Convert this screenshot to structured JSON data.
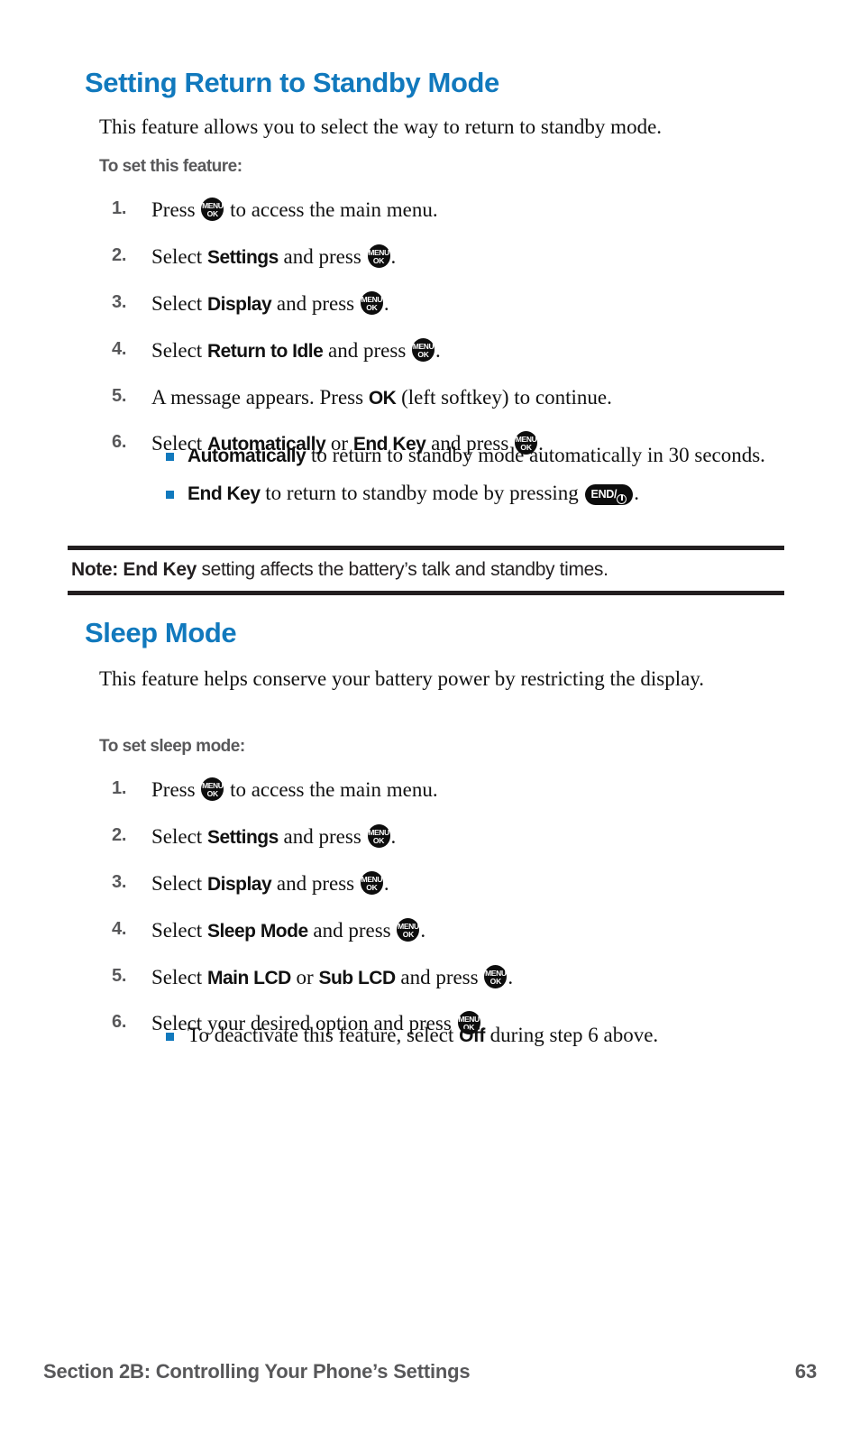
{
  "page": {
    "number": "63",
    "footer_left": "Section 2B: Controlling Your Phone’s Settings",
    "accent_color": "#1179bd",
    "text_color": "#111111",
    "muted_color": "#58585a"
  },
  "icons": {
    "menu_ok": {
      "name": "menu-ok-key-icon",
      "line1": "MENU",
      "line2": "OK"
    },
    "end_power": {
      "name": "end-power-key-icon",
      "label": "END/"
    }
  },
  "sections": [
    {
      "id": "setting-return-to-standby-mode",
      "heading": "Setting Return to Standby Mode",
      "intro": "This feature allows you to select the way to return to standby mode.",
      "subhead": "To set this feature:",
      "steps": [
        {
          "num": "1.",
          "parts": [
            {
              "t": "text",
              "v": "Press "
            },
            {
              "t": "icon",
              "v": "menu_ok"
            },
            {
              "t": "text",
              "v": " to access the main menu."
            }
          ]
        },
        {
          "num": "2.",
          "parts": [
            {
              "t": "text",
              "v": "Select "
            },
            {
              "t": "kw",
              "v": "Settings"
            },
            {
              "t": "text",
              "v": " and press "
            },
            {
              "t": "icon",
              "v": "menu_ok"
            },
            {
              "t": "text",
              "v": "."
            }
          ]
        },
        {
          "num": "3.",
          "parts": [
            {
              "t": "text",
              "v": "Select "
            },
            {
              "t": "kw",
              "v": "Display"
            },
            {
              "t": "text",
              "v": " and press "
            },
            {
              "t": "icon",
              "v": "menu_ok"
            },
            {
              "t": "text",
              "v": "."
            }
          ]
        },
        {
          "num": "4.",
          "parts": [
            {
              "t": "text",
              "v": "Select "
            },
            {
              "t": "kw",
              "v": "Return to Idle"
            },
            {
              "t": "text",
              "v": " and press "
            },
            {
              "t": "icon",
              "v": "menu_ok"
            },
            {
              "t": "text",
              "v": "."
            }
          ]
        },
        {
          "num": "5.",
          "parts": [
            {
              "t": "text",
              "v": "A message appears. Press "
            },
            {
              "t": "kw",
              "v": "OK"
            },
            {
              "t": "text",
              "v": " (left softkey) to continue."
            }
          ]
        },
        {
          "num": "6.",
          "parts": [
            {
              "t": "text",
              "v": "Select "
            },
            {
              "t": "kw",
              "v": "Automatically"
            },
            {
              "t": "text",
              "v": " or "
            },
            {
              "t": "kw",
              "v": "End Key"
            },
            {
              "t": "text",
              "v": " and press "
            },
            {
              "t": "icon",
              "v": "menu_ok"
            },
            {
              "t": "text",
              "v": "."
            }
          ]
        }
      ],
      "bullets": [
        {
          "parts": [
            {
              "t": "kw",
              "v": "Automatically"
            },
            {
              "t": "text",
              "v": " to return to standby mode automatically in 30 seconds."
            }
          ]
        },
        {
          "parts": [
            {
              "t": "kw",
              "v": "End Key"
            },
            {
              "t": "text",
              "v": " to return to standby mode by pressing "
            },
            {
              "t": "icon",
              "v": "end_power"
            },
            {
              "t": "text",
              "v": "."
            }
          ]
        }
      ],
      "note": [
        {
          "t": "nb",
          "v": "Note: "
        },
        {
          "t": "nb",
          "v": "End Key"
        },
        {
          "t": "text",
          "v": " setting affects the battery’s talk and standby times."
        }
      ]
    },
    {
      "id": "sleep-mode",
      "heading": "Sleep Mode",
      "intro": "This feature helps conserve your battery power by restricting the display.",
      "subhead": "To set sleep mode:",
      "steps": [
        {
          "num": "1.",
          "parts": [
            {
              "t": "text",
              "v": "Press "
            },
            {
              "t": "icon",
              "v": "menu_ok"
            },
            {
              "t": "text",
              "v": " to access the main menu."
            }
          ]
        },
        {
          "num": "2.",
          "parts": [
            {
              "t": "text",
              "v": "Select "
            },
            {
              "t": "kw",
              "v": "Settings"
            },
            {
              "t": "text",
              "v": " and press "
            },
            {
              "t": "icon",
              "v": "menu_ok"
            },
            {
              "t": "text",
              "v": "."
            }
          ]
        },
        {
          "num": "3.",
          "parts": [
            {
              "t": "text",
              "v": "Select "
            },
            {
              "t": "kw",
              "v": "Display"
            },
            {
              "t": "text",
              "v": " and press "
            },
            {
              "t": "icon",
              "v": "menu_ok"
            },
            {
              "t": "text",
              "v": "."
            }
          ]
        },
        {
          "num": "4.",
          "parts": [
            {
              "t": "text",
              "v": "Select "
            },
            {
              "t": "kw",
              "v": "Sleep Mode"
            },
            {
              "t": "text",
              "v": " and press "
            },
            {
              "t": "icon",
              "v": "menu_ok"
            },
            {
              "t": "text",
              "v": "."
            }
          ]
        },
        {
          "num": "5.",
          "parts": [
            {
              "t": "text",
              "v": "Select "
            },
            {
              "t": "kw",
              "v": "Main LCD"
            },
            {
              "t": "text",
              "v": " or "
            },
            {
              "t": "kw",
              "v": "Sub LCD"
            },
            {
              "t": "text",
              "v": " and press "
            },
            {
              "t": "icon",
              "v": "menu_ok"
            },
            {
              "t": "text",
              "v": "."
            }
          ]
        },
        {
          "num": "6.",
          "parts": [
            {
              "t": "text",
              "v": "Select your desired option and press "
            },
            {
              "t": "icon",
              "v": "menu_ok"
            },
            {
              "t": "text",
              "v": "."
            }
          ]
        }
      ],
      "bullets": [
        {
          "parts": [
            {
              "t": "text",
              "v": "To deactivate this feature, select "
            },
            {
              "t": "kw",
              "v": "Off"
            },
            {
              "t": "text",
              "v": " during step 6 above."
            }
          ]
        }
      ],
      "note": null
    }
  ]
}
